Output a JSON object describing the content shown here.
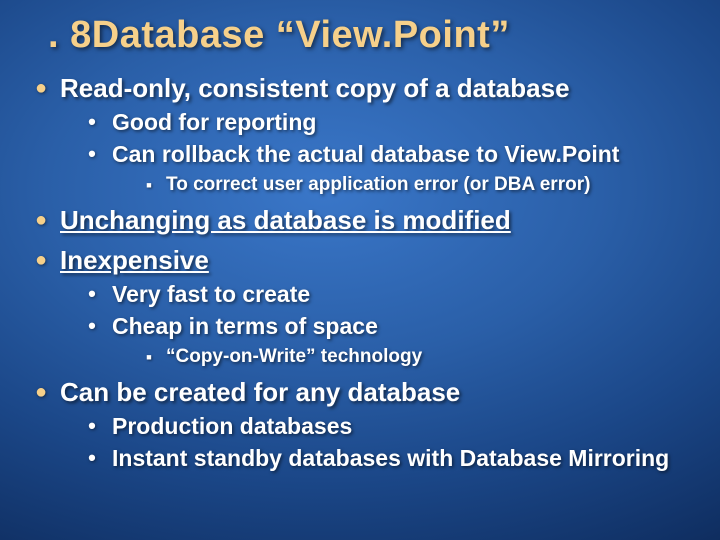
{
  "title": ". 8Database “View.Point”",
  "items": [
    {
      "text": "Read-only, consistent copy of a database",
      "children": [
        {
          "text": "Good for reporting"
        },
        {
          "text": "Can rollback the actual database to View.Point",
          "children": [
            {
              "text": "To correct user application error (or DBA error)"
            }
          ]
        }
      ]
    },
    {
      "text": "Unchanging as database is modified",
      "underline": true
    },
    {
      "text": "Inexpensive",
      "underline": true,
      "children": [
        {
          "text": "Very fast to create"
        },
        {
          "text": "Cheap in terms of space",
          "children": [
            {
              "text": "“Copy-on-Write” technology"
            }
          ]
        }
      ]
    },
    {
      "text": "Can be created for any database",
      "children": [
        {
          "text": "Production databases"
        },
        {
          "text": "Instant standby databases with Database Mirroring"
        }
      ]
    }
  ]
}
